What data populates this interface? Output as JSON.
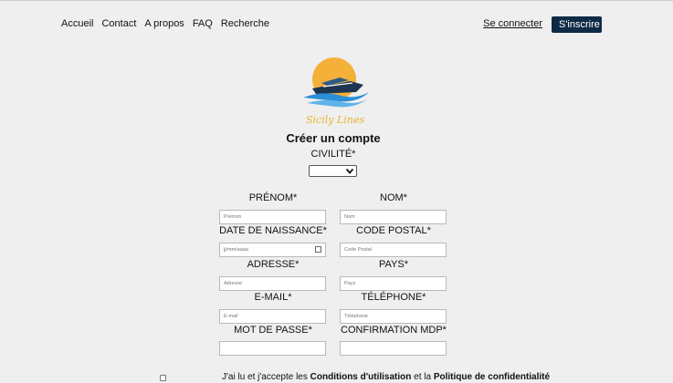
{
  "nav": {
    "items": [
      "Accueil",
      "Contact",
      "A propos",
      "FAQ",
      "Recherche"
    ]
  },
  "auth": {
    "login_label": "Se connecter",
    "signup_label": "S'inscrire",
    "signup_color": "#0e2b45"
  },
  "logo": {
    "text": "Sicily Lines",
    "sun_color": "#f4b13a",
    "wave_color": "#2a8fd6"
  },
  "form": {
    "title": "Créer un compte",
    "civility_label": "CIVILITÉ*",
    "civility_value": "",
    "fields": {
      "prenom": {
        "label": "PRÉNOM*",
        "placeholder": "Prénom"
      },
      "nom": {
        "label": "NOM*",
        "placeholder": "Nom"
      },
      "naissance": {
        "label": "DATE DE NAISSANCE*",
        "placeholder": "jj/mm/aaaa"
      },
      "code_postal": {
        "label": "CODE POSTAL*",
        "placeholder": "Code Postal"
      },
      "adresse": {
        "label": "ADRESSE*",
        "placeholder": "Adresse"
      },
      "pays": {
        "label": "PAYS*",
        "placeholder": "Pays"
      },
      "email": {
        "label": "E-MAIL*",
        "placeholder": "E-mail"
      },
      "telephone": {
        "label": "TÉLÉPHONE*",
        "placeholder": "Téléphone"
      },
      "mdp": {
        "label": "MOT DE PASSE*",
        "placeholder": ""
      },
      "mdp_confirm": {
        "label": "CONFIRMATION MDP*",
        "placeholder": ""
      }
    },
    "terms": {
      "prefix": "J'ai lu et j'accepte les ",
      "cgu": "Conditions d'utilisation",
      "middle": " et la ",
      "privacy": "Politique de confidentialité"
    }
  }
}
